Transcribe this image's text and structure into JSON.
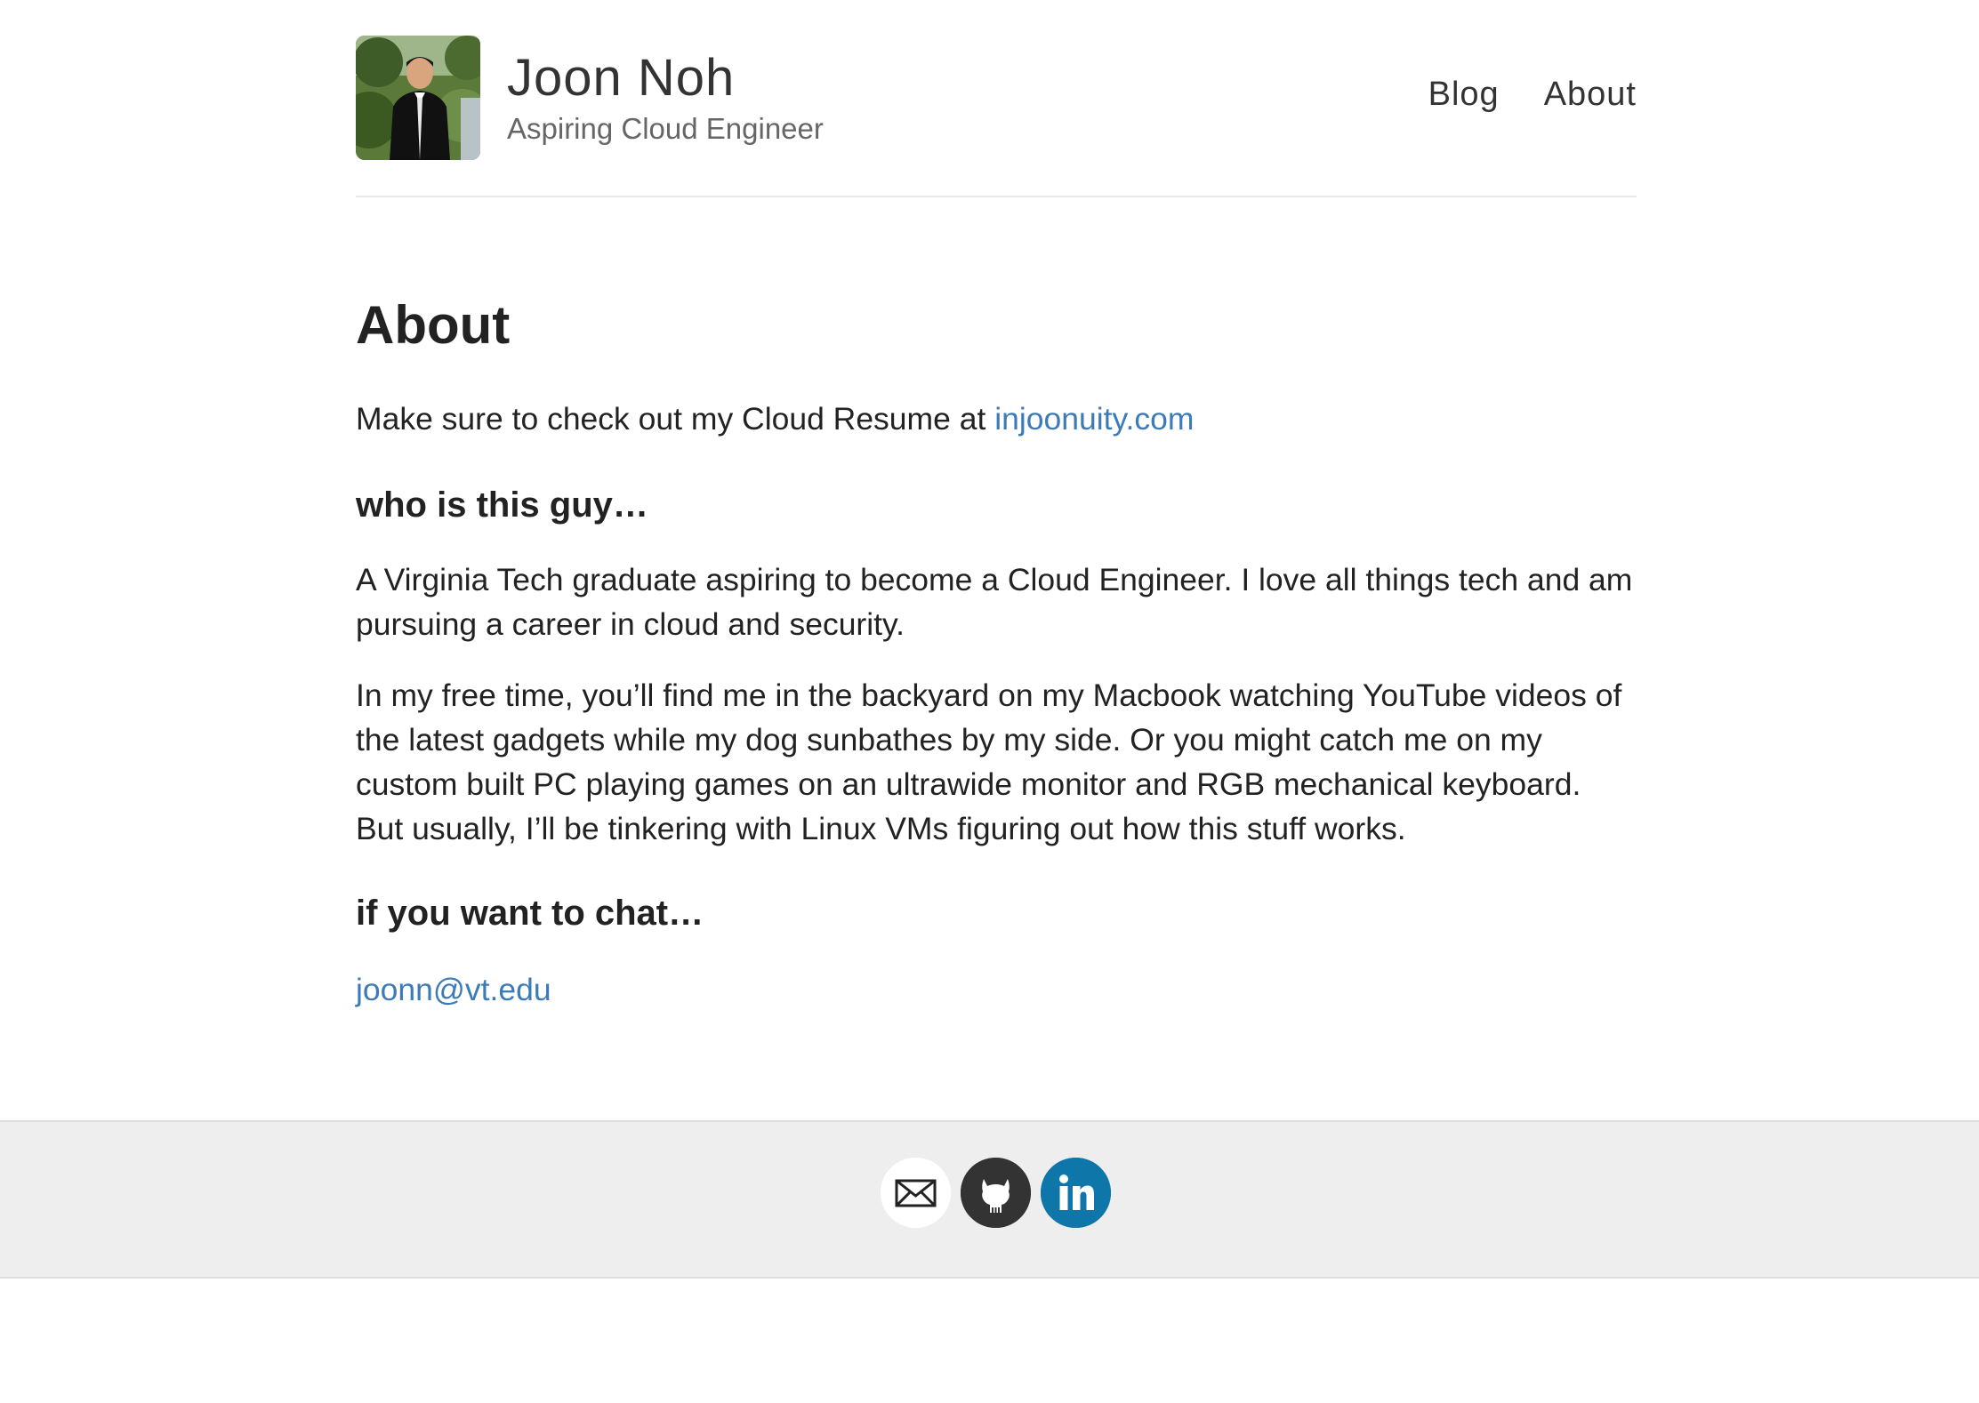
{
  "header": {
    "site_title": "Joon Noh",
    "site_subtitle": "Aspiring Cloud Engineer",
    "avatar_icon": "profile-photo",
    "nav": [
      {
        "label": "Blog"
      },
      {
        "label": "About"
      }
    ]
  },
  "main": {
    "title": "About",
    "intro_text": "Make sure to check out my Cloud Resume at ",
    "intro_link": "injoonuity.com",
    "sections": [
      {
        "heading": "who is this guy…",
        "paragraphs": [
          "A Virginia Tech graduate aspiring to become a Cloud Engineer. I love all things tech and am pursuing a career in cloud and security.",
          "In my free time, you’ll find me in the backyard on my Macbook watching YouTube videos of the latest gadgets while my dog sunbathes by my side. Or you might catch me on my custom built PC playing games on an ultrawide monitor and RGB mechanical keyboard. But usually, I’ll be tinkering with Linux VMs figuring out how this stuff works."
        ]
      },
      {
        "heading": "if you want to chat…",
        "contact_email": "joonn@vt.edu"
      }
    ]
  },
  "footer": {
    "social": [
      {
        "icon": "email-icon",
        "color": "#ffffff"
      },
      {
        "icon": "github-icon",
        "color": "#333333"
      },
      {
        "icon": "linkedin-icon",
        "color": "#0e76a8"
      }
    ]
  },
  "colors": {
    "link": "#3d7ab8",
    "footer_bg": "#eeeeee",
    "text": "#222222"
  }
}
